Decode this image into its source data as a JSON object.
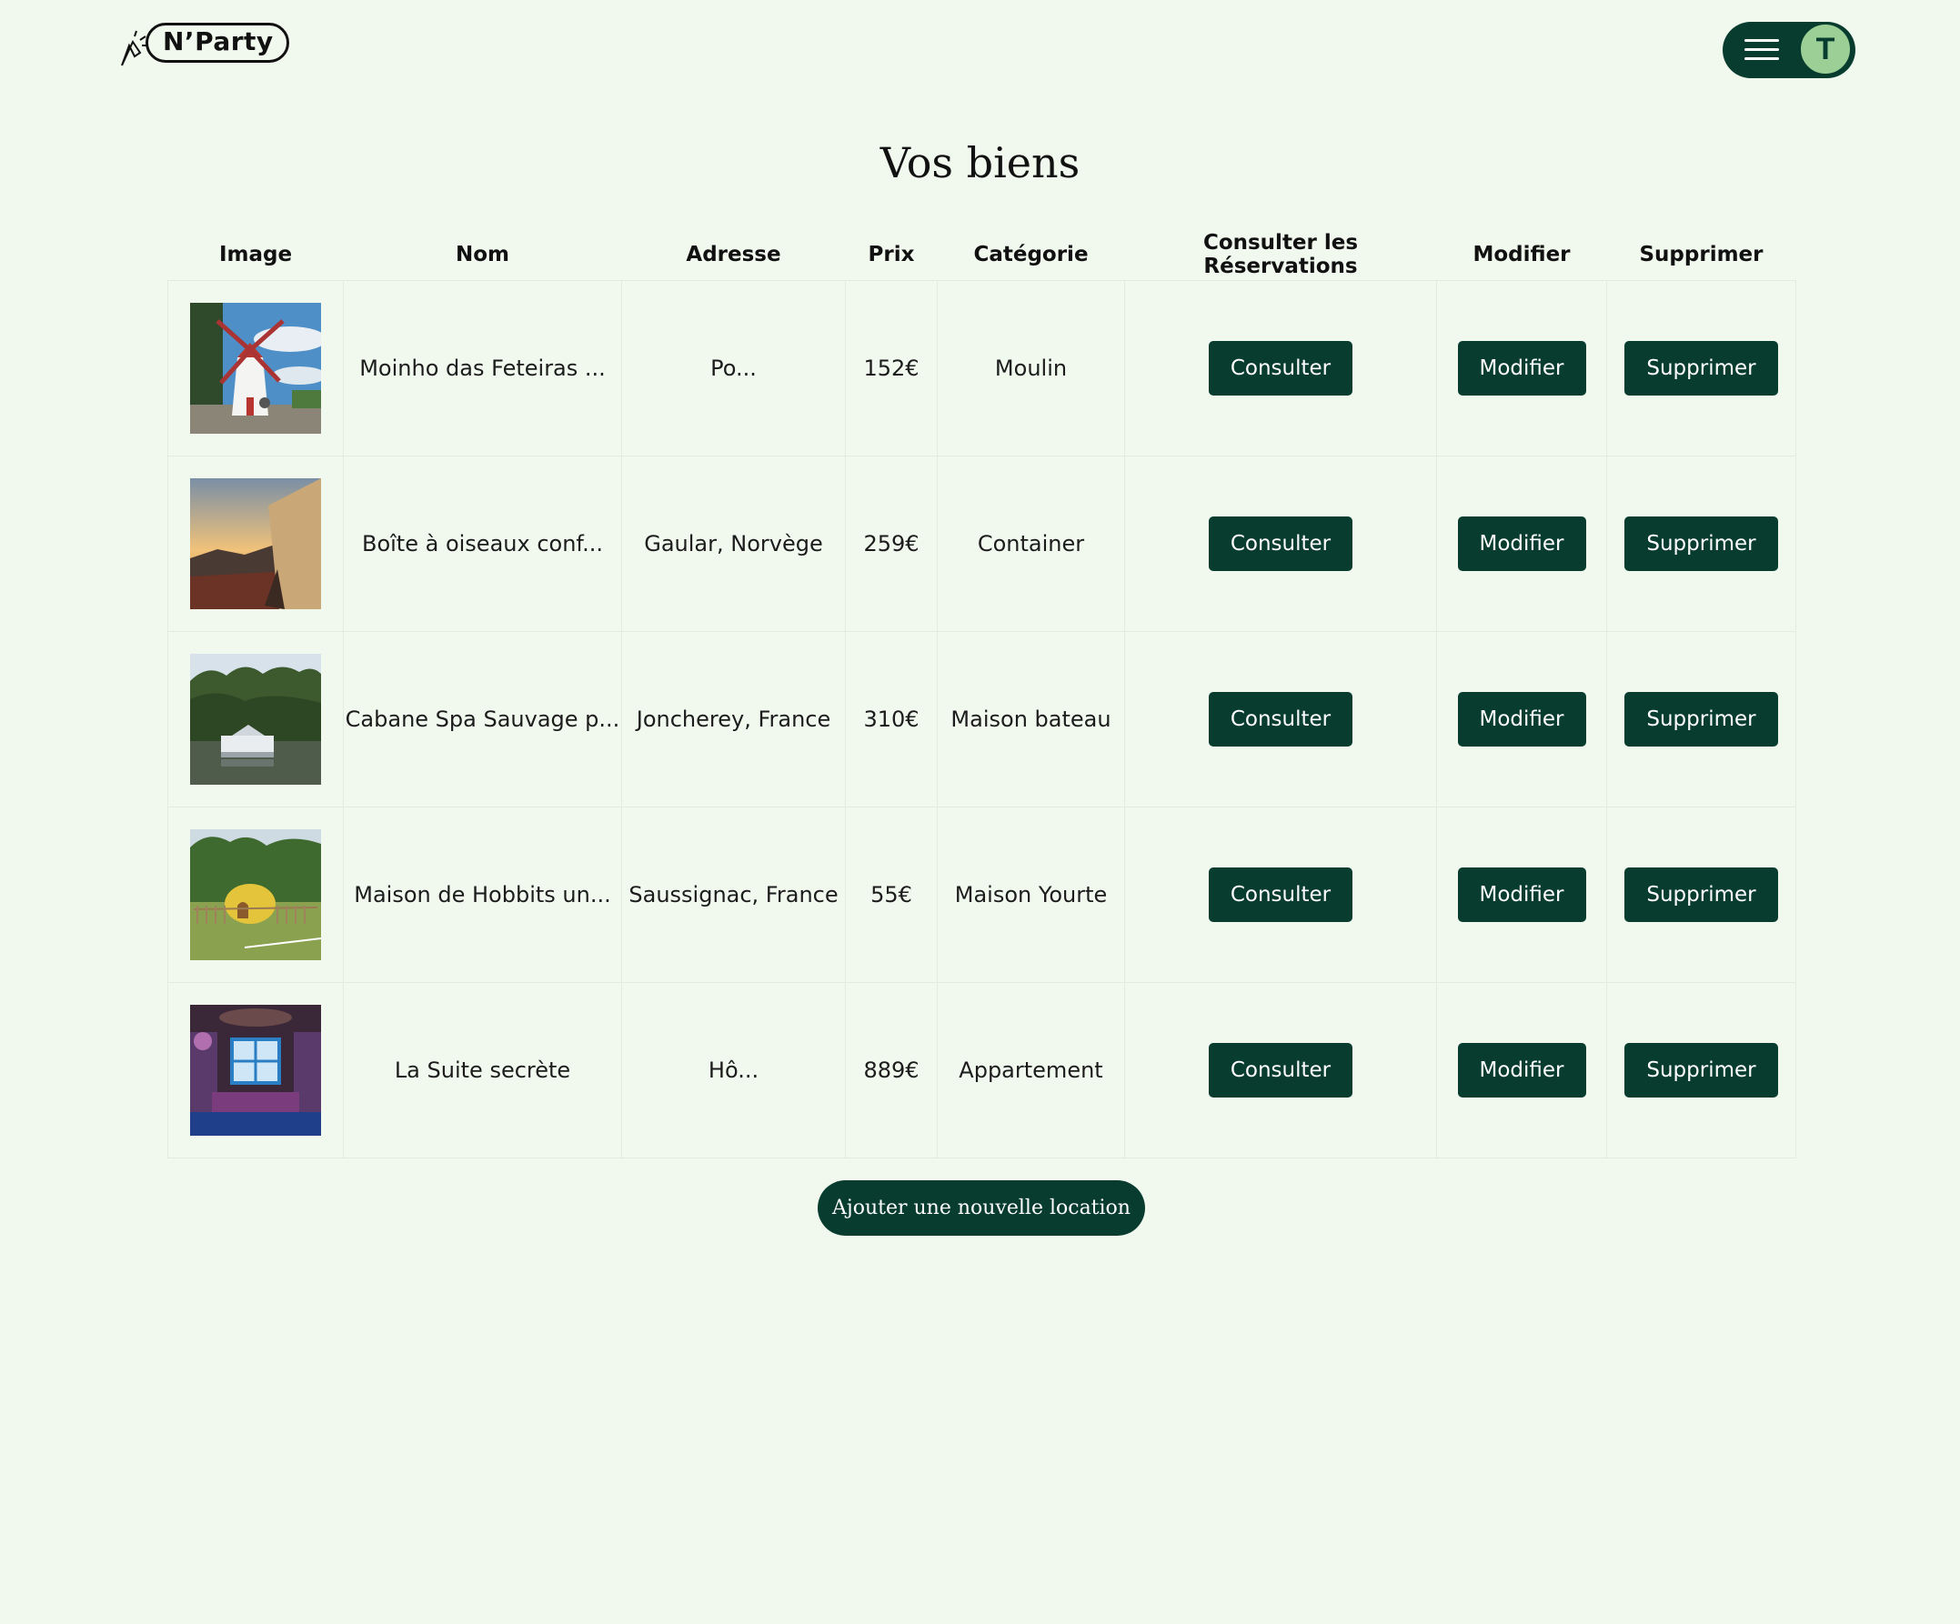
{
  "header": {
    "logo_text": "N’Party",
    "avatar_initial": "T"
  },
  "page": {
    "title": "Vos biens",
    "add_button_label": "Ajouter une nouvelle location"
  },
  "table": {
    "columns": [
      "Image",
      "Nom",
      "Adresse",
      "Prix",
      "Catégorie",
      "Consulter les Réservations",
      "Modifier",
      "Supprimer"
    ],
    "rows": [
      {
        "name": "Moinho das Feteiras ...",
        "address": "Po...",
        "price": "152€",
        "category": "Moulin",
        "consult_label": "Consulter",
        "edit_label": "Modifier",
        "delete_label": "Supprimer"
      },
      {
        "name": "Boîte à oiseaux conf...",
        "address": "Gaular, Norvège",
        "price": "259€",
        "category": "Container",
        "consult_label": "Consulter",
        "edit_label": "Modifier",
        "delete_label": "Supprimer"
      },
      {
        "name": "Cabane Spa Sauvage p...",
        "address": "Joncherey, France",
        "price": "310€",
        "category": "Maison bateau",
        "consult_label": "Consulter",
        "edit_label": "Modifier",
        "delete_label": "Supprimer"
      },
      {
        "name": "Maison de Hobbits un...",
        "address": "Saussignac, France",
        "price": "55€",
        "category": "Maison Yourte",
        "consult_label": "Consulter",
        "edit_label": "Modifier",
        "delete_label": "Supprimer"
      },
      {
        "name": "La Suite secrète",
        "address": "Hô...",
        "price": "889€",
        "category": "Appartement",
        "consult_label": "Consulter",
        "edit_label": "Modifier",
        "delete_label": "Supprimer"
      }
    ]
  },
  "colors": {
    "background": "#f1f9ef",
    "primary": "#073c2f",
    "avatar": "#9bcf95"
  },
  "icons": {
    "logo": "cursor-click-icon",
    "menu": "hamburger-icon"
  }
}
